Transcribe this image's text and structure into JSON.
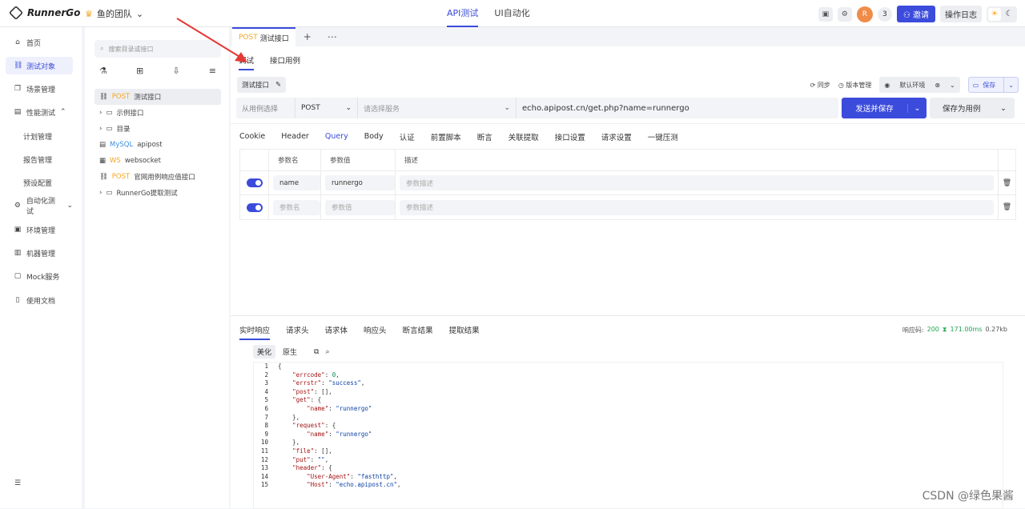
{
  "topbar": {
    "app_name": "RunnerGo",
    "team": "鱼的团队",
    "modes": [
      "API测试",
      "UI自动化"
    ],
    "member_count": "3",
    "invite_label": "邀请",
    "oplog_label": "操作日志"
  },
  "sidenav": {
    "items": [
      {
        "label": "首页",
        "icon": "home-icon"
      },
      {
        "label": "测试对象",
        "icon": "link-icon"
      },
      {
        "label": "场景管理",
        "icon": "scene-icon"
      },
      {
        "label": "性能测试",
        "icon": "performance-icon"
      },
      {
        "label": "计划管理"
      },
      {
        "label": "报告管理"
      },
      {
        "label": "预设配置"
      },
      {
        "label": "自动化测试",
        "icon": "automation-icon"
      },
      {
        "label": "环境管理",
        "icon": "env-icon"
      },
      {
        "label": "机器管理",
        "icon": "machine-icon"
      },
      {
        "label": "Mock服务",
        "icon": "mock-icon"
      },
      {
        "label": "使用文档",
        "icon": "doc-icon"
      }
    ]
  },
  "tree": {
    "search_placeholder": "搜索目录或接口",
    "items": [
      {
        "method": "POST",
        "name": "测试接口"
      },
      {
        "method": "",
        "name": "示例接口"
      },
      {
        "method": "",
        "name": "目录"
      },
      {
        "method": "MySQL",
        "name": "apipost"
      },
      {
        "method": "WS",
        "name": "websocket"
      },
      {
        "method": "POST",
        "name": "官网用例响应值接口"
      },
      {
        "method": "",
        "name": "RunnerGo提取测试"
      }
    ]
  },
  "main": {
    "tab": {
      "method": "POST",
      "name": "测试接口"
    },
    "subtabs": [
      "调试",
      "接口用例"
    ],
    "api_name": "测试接口",
    "actions": {
      "sync": "同步",
      "version": "版本管理",
      "env": "默认环境",
      "save": "保存"
    },
    "url_bar": {
      "case_select": "从用例选择",
      "method": "POST",
      "service_placeholder": "请选择服务",
      "url": "echo.apipost.cn/get.php?name=runnergo",
      "send_label": "发送并保存",
      "save_case_label": "保存为用例"
    },
    "req_tabs": [
      "Cookie",
      "Header",
      "Query",
      "Body",
      "认证",
      "前置脚本",
      "断言",
      "关联提取",
      "接口设置",
      "请求设置",
      "一键压测"
    ],
    "params": {
      "headers": [
        "参数名",
        "参数值",
        "描述"
      ],
      "rows": [
        {
          "name": "name",
          "value": "runnergo",
          "desc": "参数描述"
        },
        {
          "name": "参数名",
          "value": "参数值",
          "desc": "参数描述"
        }
      ]
    },
    "response": {
      "tabs": [
        "实时响应",
        "请求头",
        "请求体",
        "响应头",
        "断言结果",
        "提取结果"
      ],
      "status_label": "响应码:",
      "status_code": "200",
      "time": "171.00ms",
      "size": "0.27kb",
      "view_modes": [
        "美化",
        "原生"
      ],
      "code_lines": [
        "{",
        "    \"errcode\": 0,",
        "    \"errstr\": \"success\",",
        "    \"post\": [],",
        "    \"get\": {",
        "        \"name\": \"runnergo\"",
        "    },",
        "    \"request\": {",
        "        \"name\": \"runnergo\"",
        "    },",
        "    \"file\": [],",
        "    \"put\": \"\",",
        "    \"header\": {",
        "        \"User-Agent\": \"fasthttp\",",
        "        \"Host\": \"echo.apipost.cn\","
      ]
    }
  },
  "watermark": "CSDN @绿色果酱",
  "colors": {
    "accent": "#3b4bdb",
    "post": "#f5a623",
    "success": "#22a550",
    "annotation_arrow": "#e53935"
  }
}
